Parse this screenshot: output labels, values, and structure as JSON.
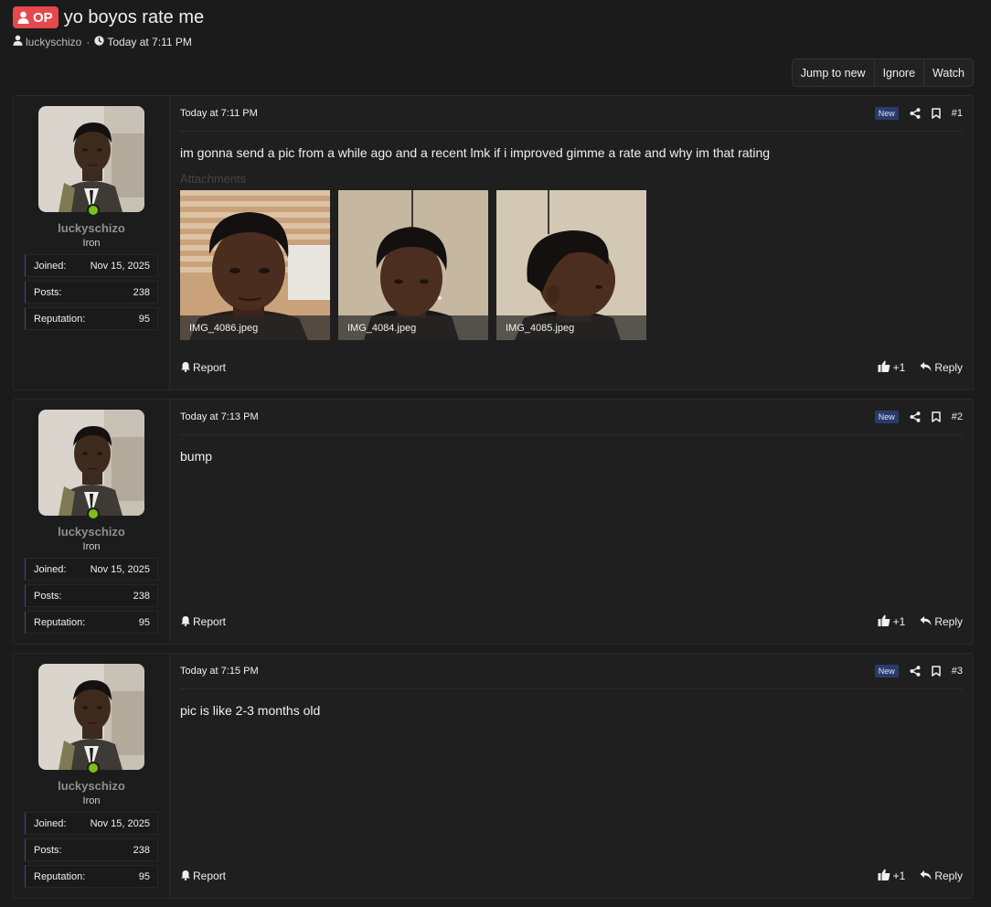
{
  "thread": {
    "op_label": "OP",
    "title": "yo boyos rate me",
    "author": "luckyschizo",
    "separator": "·",
    "time": "Today at 7:11 PM"
  },
  "actions": {
    "jump_to_new": "Jump to new",
    "ignore": "Ignore",
    "watch": "Watch"
  },
  "user": {
    "name": "luckyschizo",
    "title": "Iron",
    "stats": [
      {
        "label": "Joined:",
        "value": "Nov 15, 2025"
      },
      {
        "label": "Posts:",
        "value": "238"
      },
      {
        "label": "Reputation:",
        "value": "95"
      }
    ]
  },
  "posts": [
    {
      "date": "Today at 7:11 PM",
      "badge": "New",
      "number": "#1",
      "body": "im gonna send a pic from a while ago and a recent lmk if i improved gimme a rate and why im that rating",
      "attachments_label": "Attachments",
      "attachments": [
        "IMG_4086.jpeg",
        "IMG_4084.jpeg",
        "IMG_4085.jpeg"
      ],
      "report": "Report",
      "like": "+1",
      "reply": "Reply"
    },
    {
      "date": "Today at 7:13 PM",
      "badge": "New",
      "number": "#2",
      "body": "bump",
      "report": "Report",
      "like": "+1",
      "reply": "Reply"
    },
    {
      "date": "Today at 7:15 PM",
      "badge": "New",
      "number": "#3",
      "body": "pic is like 2-3 months old",
      "report": "Report",
      "like": "+1",
      "reply": "Reply"
    }
  ],
  "colors": {
    "op_badge": "#e5484d",
    "online": "#7bbf1a",
    "new_badge": "#2a3a6a"
  },
  "icons": {
    "op": "user-icon",
    "author": "user-icon",
    "time": "clock-icon",
    "share": "share-icon",
    "bookmark": "bookmark-icon",
    "report": "bell-icon",
    "like": "thumbs-up-icon",
    "reply": "reply-icon"
  }
}
